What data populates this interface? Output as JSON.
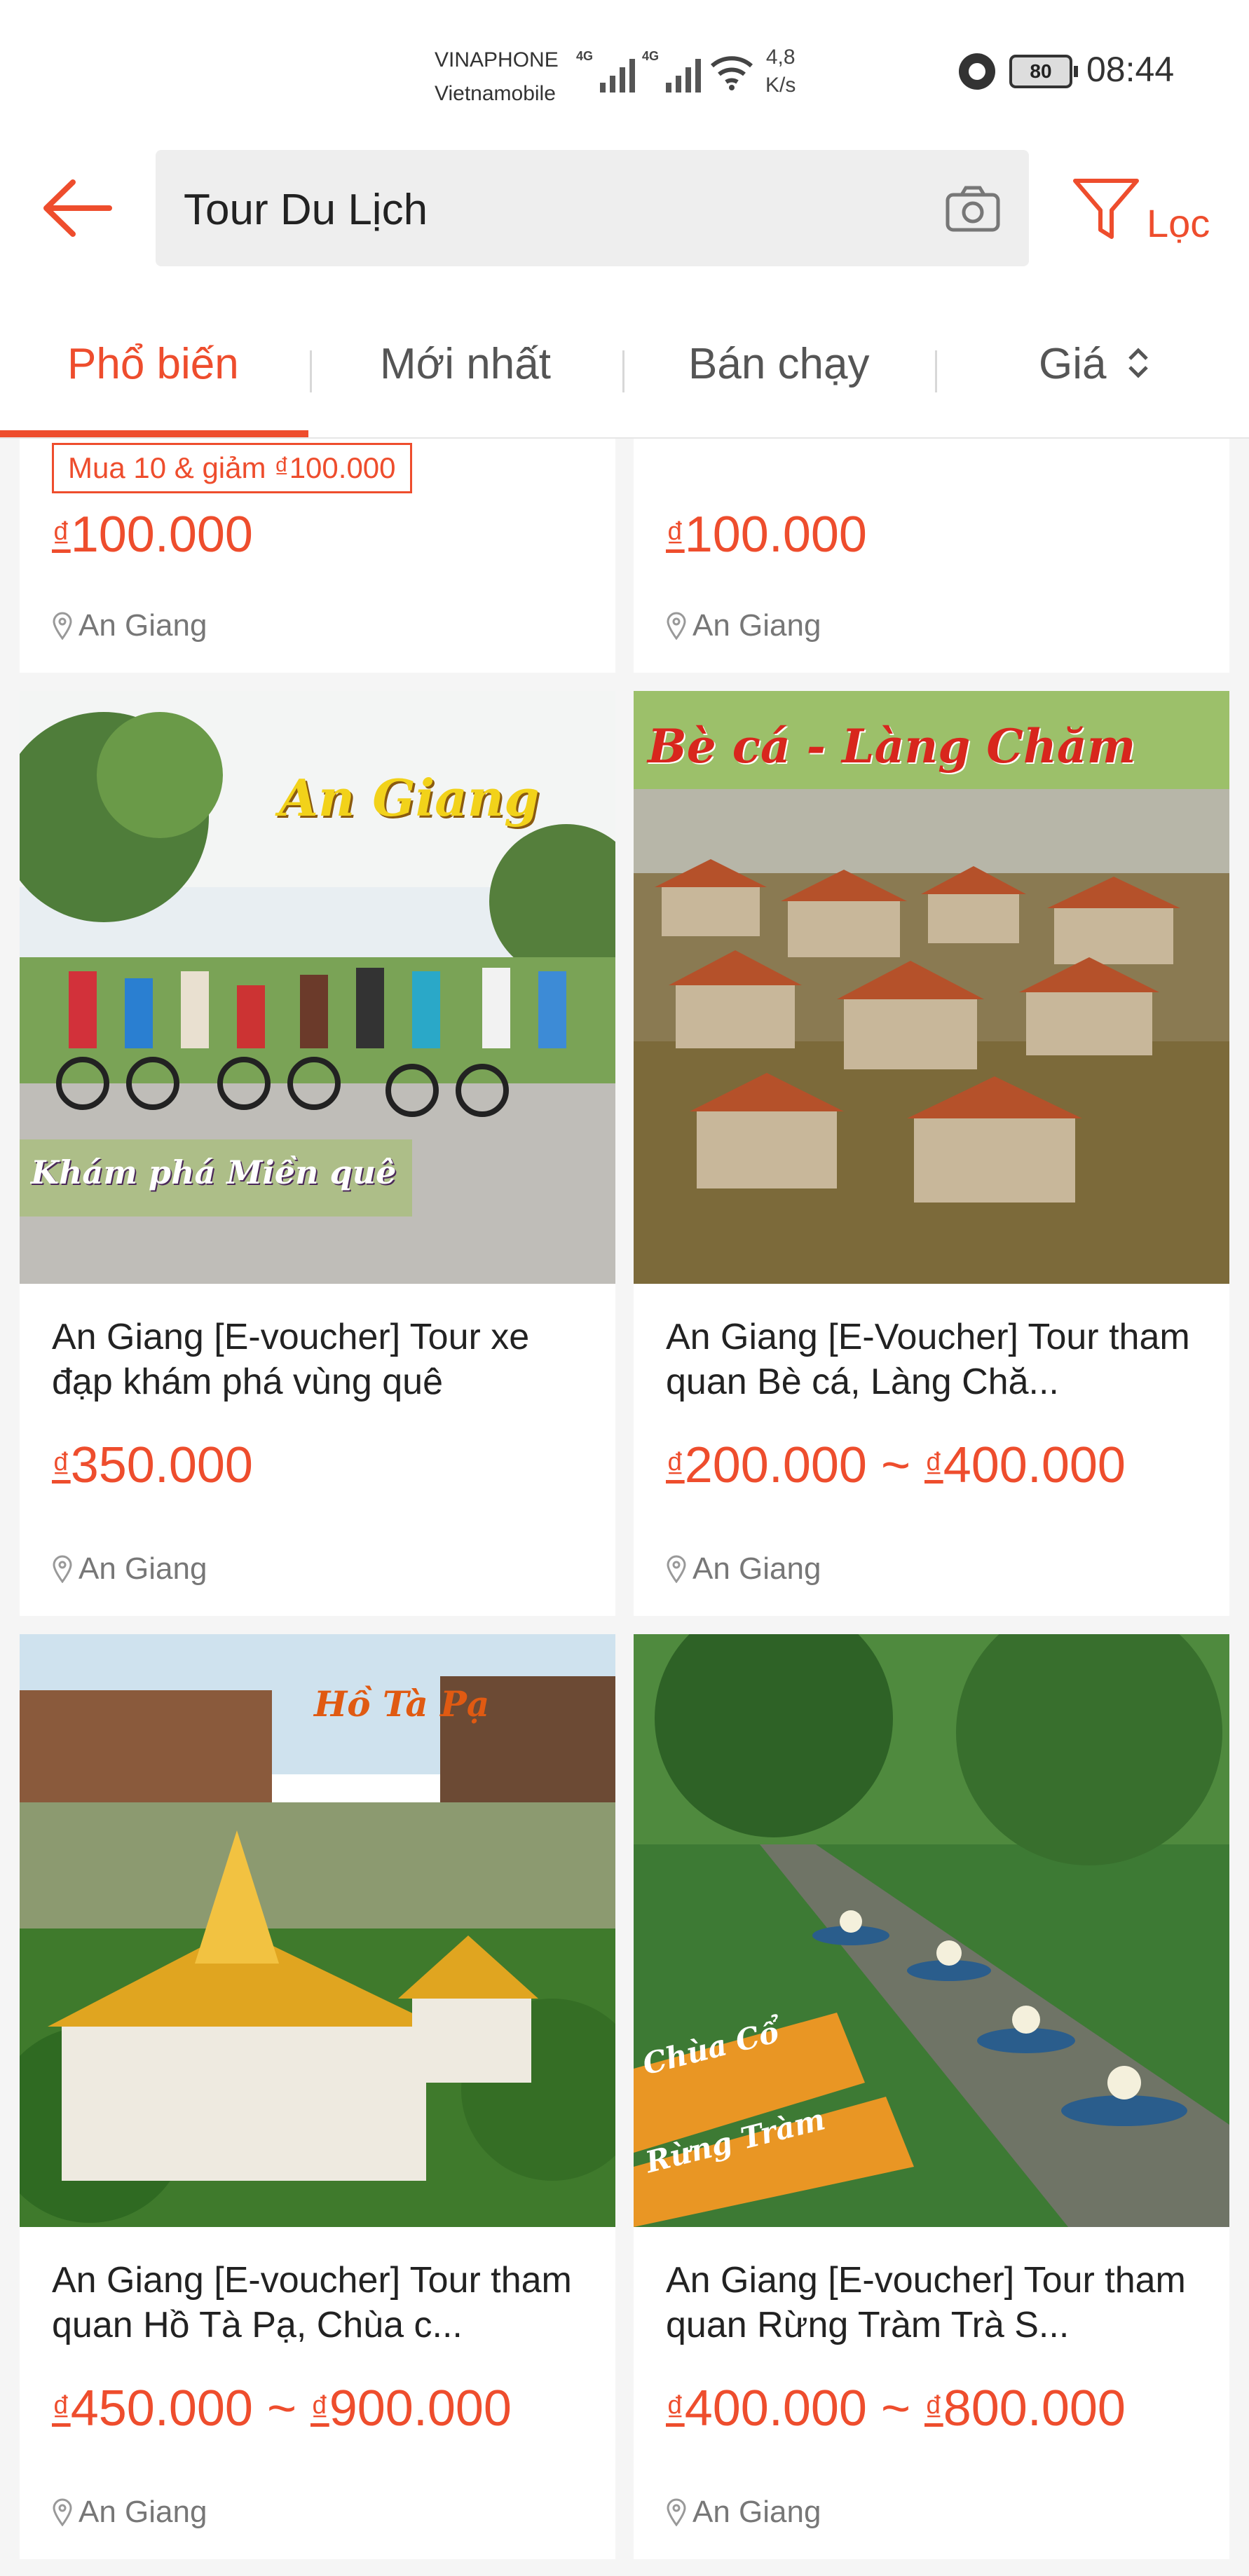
{
  "status_bar": {
    "carrier_1": "VINAPHONE",
    "carrier_2": "Vietnamobile",
    "net_1": "4G",
    "net_2": "4G",
    "speed_value": "4,8",
    "speed_unit": "K/s",
    "battery": "80",
    "time": "08:44"
  },
  "search": {
    "query": "Tour Du Lịch",
    "filter_label": "Lọc"
  },
  "tabs": [
    {
      "label": "Phổ biến",
      "active": true
    },
    {
      "label": "Mới nhất"
    },
    {
      "label": "Bán chạy"
    },
    {
      "label": "Giá"
    }
  ],
  "products": [
    {
      "voucher": "Mua 10 & giảm ₫100.000",
      "currency": "₫",
      "price": "100.000",
      "location": "An Giang"
    },
    {
      "currency": "₫",
      "price": "100.000",
      "location": "An Giang"
    },
    {
      "title": "An Giang [E-voucher] Tour xe đạp khám phá vùng quê",
      "currency": "₫",
      "price_low": "350.000",
      "location": "An Giang",
      "image_text_1": "An Giang",
      "image_text_2": "Khám phá Miền quê"
    },
    {
      "title": "An Giang [E-Voucher] Tour tham quan Bè cá, Làng Chă...",
      "currency": "₫",
      "price_low": "200.000",
      "price_sep": " ~ ",
      "price_high": "400.000",
      "location": "An Giang",
      "image_text_1": "Bè cá - Làng Chăm"
    },
    {
      "title": "An Giang [E-voucher] Tour tham quan Hồ Tà Pạ, Chùa c...",
      "currency": "₫",
      "price_low": "450.000",
      "price_sep": " ~ ",
      "price_high": "900.000",
      "location": "An Giang",
      "image_text_1": "Hồ Tà Pạ"
    },
    {
      "title": "An Giang [E-voucher] Tour tham quan Rừng Tràm Trà S...",
      "currency": "₫",
      "price_low": "400.000",
      "price_sep": " ~ ",
      "price_high": "800.000",
      "location": "An Giang",
      "image_text_1": "Chùa Cổ",
      "image_text_2": "Rừng Tràm"
    }
  ],
  "colors": {
    "accent": "#ee4d2d",
    "background": "#f5f5f5"
  }
}
